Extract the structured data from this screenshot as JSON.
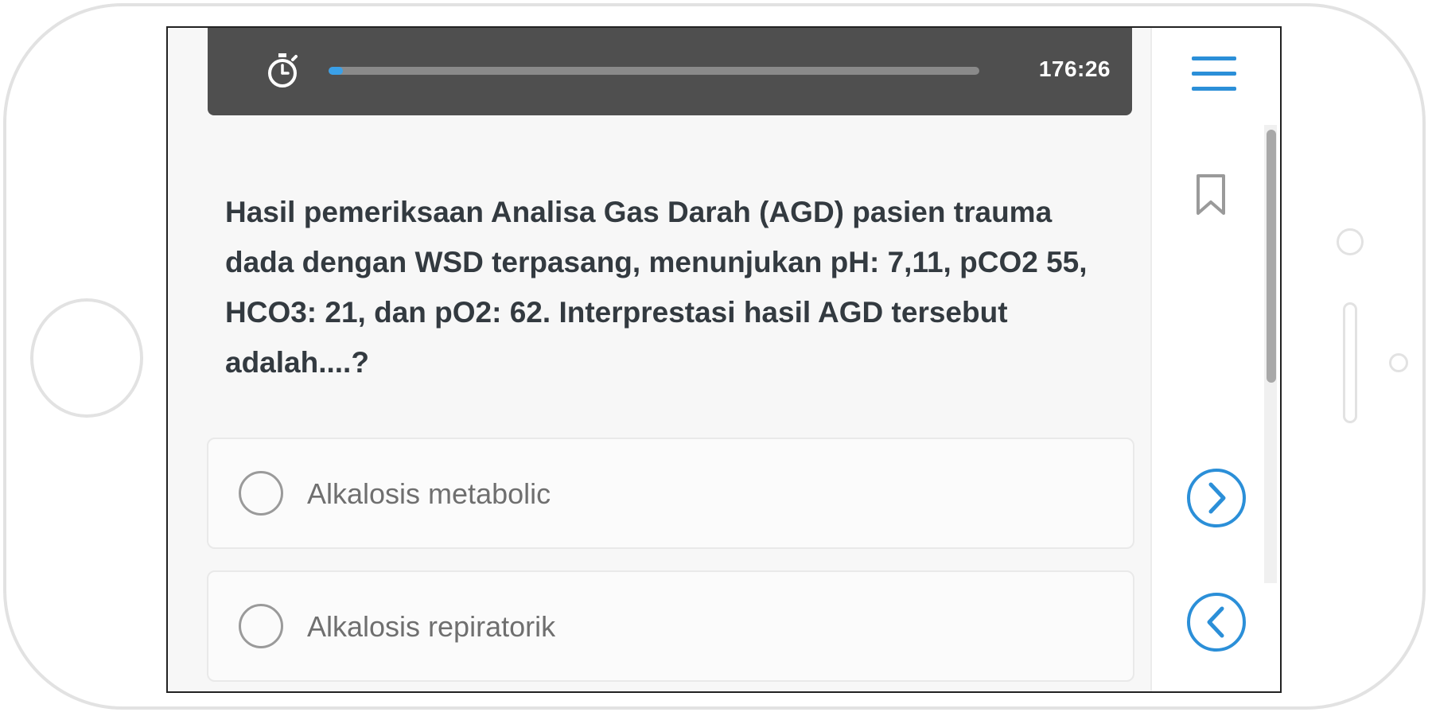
{
  "timer": {
    "time_remaining": "176:26",
    "progress_fraction": 0.022,
    "progress_color": "#3aa0e8",
    "icon": "stopwatch-icon"
  },
  "question": {
    "text": "Hasil pemeriksaan Analisa Gas Darah (AGD) pasien trauma dada dengan WSD terpasang, menunjukan pH: 7,11, pCO2 55, HCO3: 21, dan pO2: 62. Interprestasi hasil AGD tersebut adalah....?"
  },
  "options": [
    {
      "label": "Alkalosis metabolic",
      "selected": false
    },
    {
      "label": "Alkalosis repiratorik",
      "selected": false
    }
  ],
  "side_panel": {
    "menu_icon": "hamburger-menu-icon",
    "bookmark_icon": "bookmark-icon",
    "next_icon": "chevron-right-circle-icon",
    "prev_icon": "chevron-left-circle-icon",
    "accent_color": "#2b8fd8"
  }
}
